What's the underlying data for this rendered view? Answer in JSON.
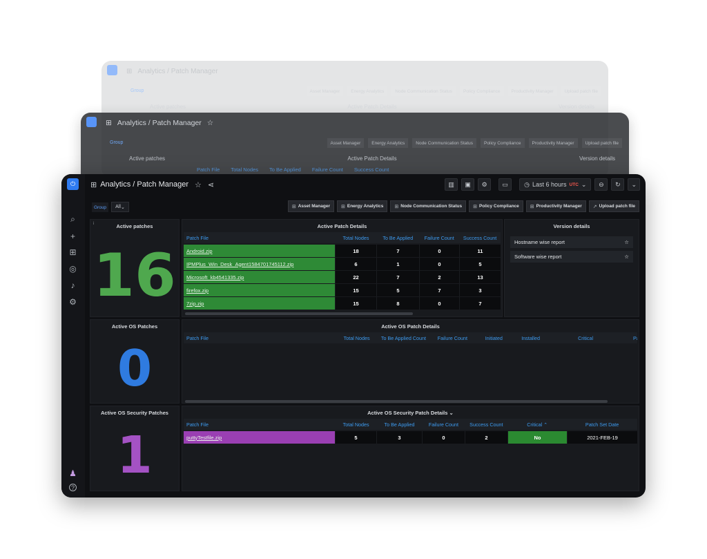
{
  "app": {
    "title": "Analytics / Patch Manager",
    "logo_icon": "power-icon"
  },
  "sidebar": {
    "items": [
      {
        "name": "search-icon",
        "glyph": "⌕"
      },
      {
        "name": "plus-icon",
        "glyph": "+"
      },
      {
        "name": "dashboards-icon",
        "glyph": "⊞"
      },
      {
        "name": "explore-icon",
        "glyph": "◎"
      },
      {
        "name": "alerts-icon",
        "glyph": "♪"
      },
      {
        "name": "settings-icon",
        "glyph": "⚙"
      }
    ],
    "bottom": [
      {
        "name": "user-avatar-icon",
        "glyph": "♟"
      },
      {
        "name": "help-icon",
        "glyph": "?"
      }
    ]
  },
  "toolbar": {
    "time_range": "Last 6 hours",
    "timezone": "UTC",
    "add_panel_icon": "add-panel-icon",
    "save_icon": "save-icon",
    "settings_icon": "gear-icon",
    "tv_icon": "tv-mode-icon",
    "zoom_icon": "zoom-out-icon",
    "refresh_icon": "refresh-icon"
  },
  "filters": {
    "group_label": "Group",
    "group_value": "All"
  },
  "links": [
    "Asset Manager",
    "Energy Analytics",
    "Node Communication Status",
    "Policy Compliance",
    "Productivity Manager",
    "Upload patch file"
  ],
  "panels": {
    "active_patches": {
      "title": "Active patches",
      "value": "16",
      "color": "#4fa84e"
    },
    "active_os_patches": {
      "title": "Active OS Patches",
      "value": "0",
      "color": "#2f7be0"
    },
    "active_os_security": {
      "title": "Active OS Security Patches",
      "value": "1",
      "color": "#a452c4"
    }
  },
  "active_patch_details": {
    "title": "Active Patch Details",
    "headers": [
      "Patch File",
      "Total Nodes",
      "To Be Applied",
      "Failure Count",
      "Success Count"
    ],
    "rows": [
      [
        "Android.zip",
        "18",
        "7",
        "0",
        "11"
      ],
      [
        "IPMPlus_Win_Desk_Agent1584701745112.zip",
        "6",
        "1",
        "0",
        "5"
      ],
      [
        "Microsoft_kb4541335.zip",
        "22",
        "7",
        "2",
        "13"
      ],
      [
        "firefox.zip",
        "15",
        "5",
        "7",
        "3"
      ],
      [
        "7zip.zip",
        "15",
        "8",
        "0",
        "7"
      ]
    ],
    "file_color": "#2e8a36"
  },
  "version_details": {
    "title": "Version details",
    "items": [
      "Hostname wise report",
      "Software wise report"
    ]
  },
  "active_os_patch_details": {
    "title": "Active OS Patch Details",
    "headers": [
      "Patch File",
      "Total Nodes",
      "To Be Applied Count",
      "Failure Count",
      "Initiated",
      "Installed",
      "Critical",
      "Patch"
    ]
  },
  "active_os_security_details": {
    "title": "Active OS Security Patch Details",
    "headers": [
      "Patch File",
      "Total Nodes",
      "To Be Applied",
      "Failure Count",
      "Success Count",
      "Critical",
      "Patch Set Date"
    ],
    "rows": [
      [
        "puttyTestfile.zip",
        "5",
        "3",
        "0",
        "2",
        "No",
        "2021-FEB-19"
      ]
    ],
    "file_color": "#9a3fb3",
    "critical_color": "#2b8a31"
  },
  "ghost_windows": {
    "title": "Analytics / Patch Manager",
    "time_range": "Last 6 hours",
    "timezone": "UTC",
    "group_label": "Group",
    "group_value": "All",
    "left_label": "Active patches",
    "mid_label": "Active Patch Details",
    "right_label": "Version details",
    "subheaders": [
      "Patch File",
      "Total Nodes",
      "To Be Applied",
      "Failure Count",
      "Success Count"
    ]
  }
}
